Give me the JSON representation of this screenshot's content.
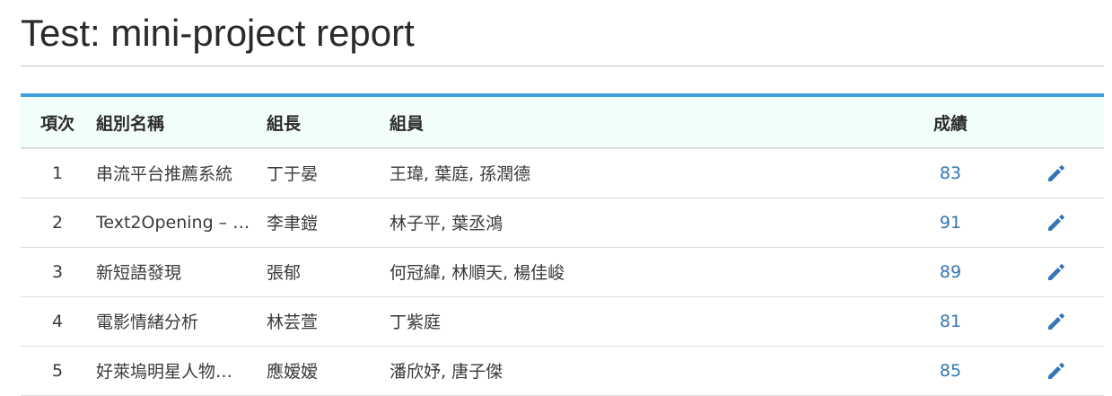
{
  "page": {
    "title": "Test: mini-project report"
  },
  "table": {
    "headers": {
      "index": "項次",
      "group_name": "組別名稱",
      "leader": "組長",
      "members": "組員",
      "score": "成績"
    },
    "rows": [
      {
        "index": "1",
        "group_name": "串流平台推薦系統",
        "leader": "丁于晏",
        "members": "王瑋, 葉庭, 孫潤德",
        "score": "83",
        "edit_icon": "pencil-icon"
      },
      {
        "index": "2",
        "group_name": "Text2Opening – …",
        "leader": "李聿鎧",
        "members": "林子平, 葉丞鴻",
        "score": "91",
        "edit_icon": "pencil-icon"
      },
      {
        "index": "3",
        "group_name": "新短語發現",
        "leader": "張郁",
        "members": "何冠緯, 林順天, 楊佳峻",
        "score": "89",
        "edit_icon": "pencil-icon"
      },
      {
        "index": "4",
        "group_name": "電影情緒分析",
        "leader": "林芸萱",
        "members": "丁紫庭",
        "score": "81",
        "edit_icon": "pencil-icon"
      },
      {
        "index": "5",
        "group_name": "好萊塢明星人物…",
        "leader": "應嫒嫒",
        "members": "潘欣妤, 唐子傑",
        "score": "85",
        "edit_icon": "pencil-icon"
      }
    ]
  },
  "colors": {
    "accent": "#3ea1dd",
    "header_bg": "#f1fefc",
    "link": "#3376b5"
  }
}
